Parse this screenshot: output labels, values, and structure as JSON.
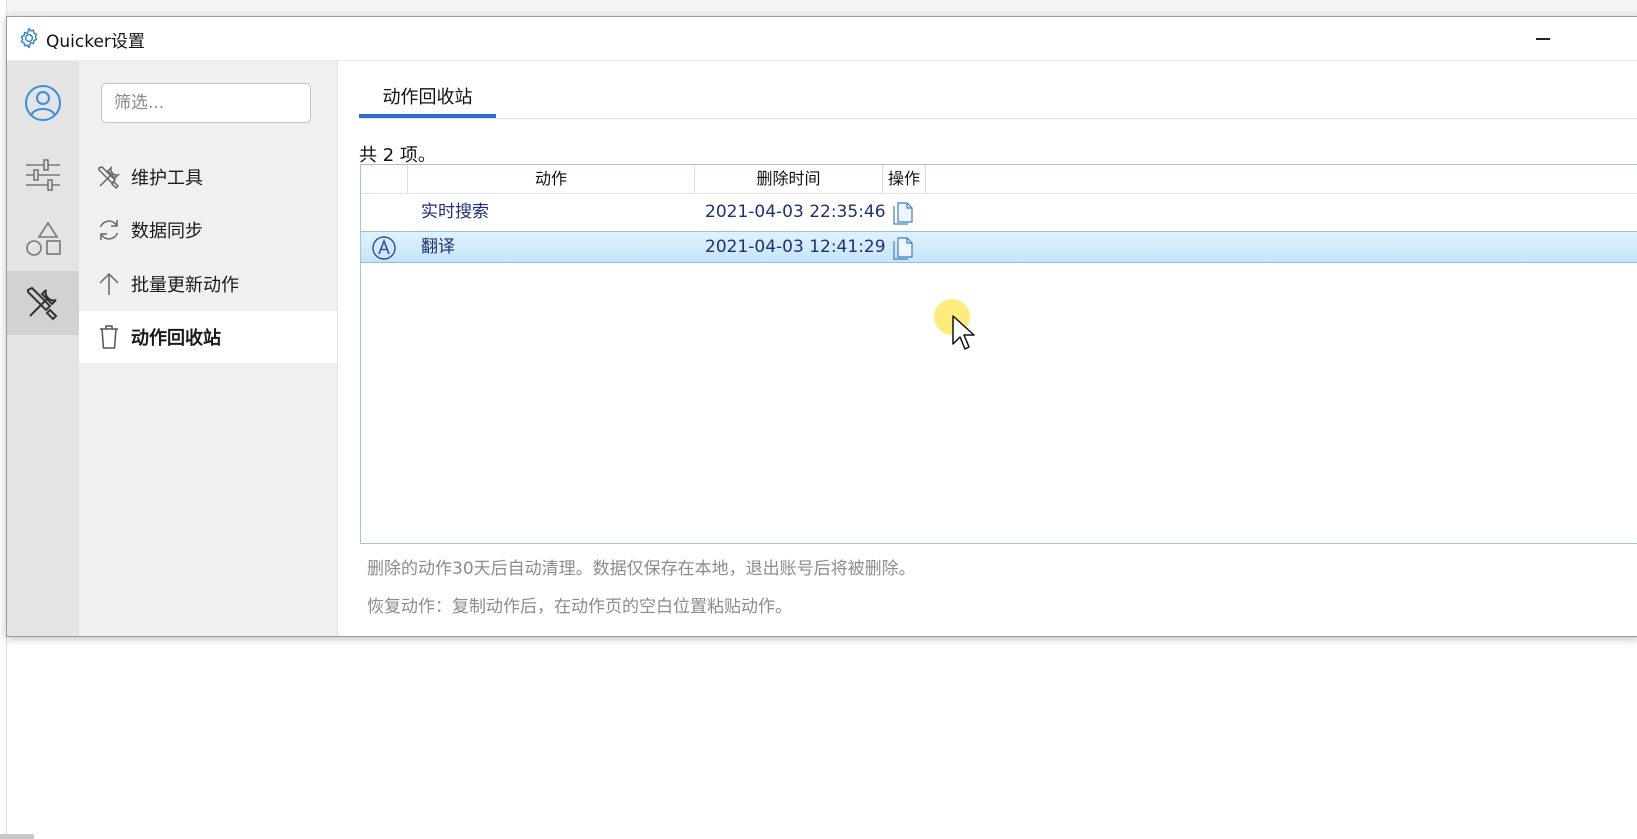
{
  "window": {
    "title": "Quicker设置"
  },
  "rail": {
    "items": [
      {
        "icon": "user-circle-icon"
      },
      {
        "icon": "sliders-icon"
      },
      {
        "icon": "shapes-icon"
      },
      {
        "icon": "tools-icon",
        "active": true
      }
    ]
  },
  "menu": {
    "filter_placeholder": "筛选...",
    "items": [
      {
        "label": "维护工具",
        "icon": "tools-icon"
      },
      {
        "label": "数据同步",
        "icon": "sync-icon"
      },
      {
        "label": "批量更新动作",
        "icon": "arrow-up-icon"
      },
      {
        "label": "动作回收站",
        "icon": "trash-icon",
        "active": true
      }
    ]
  },
  "content": {
    "tab_label": "动作回收站",
    "count_text": "共 2 项。",
    "columns": {
      "action": "动作",
      "deleted_time": "删除时间",
      "operation": "操作"
    },
    "rows": [
      {
        "name": "实时搜索",
        "deleted_time": "2021-04-03 22:35:46",
        "icon": ""
      },
      {
        "name": "翻译",
        "deleted_time": "2021-04-03 12:41:29",
        "icon": "translate-icon",
        "selected": true
      }
    ],
    "notes": [
      "删除的动作30天后自动清理。数据仅保存在本地，退出账号后将被删除。",
      "恢复动作：复制动作后，在动作页的空白位置粘贴动作。"
    ]
  },
  "colors": {
    "accent": "#2b6fd6",
    "selection": "#c6e4fa",
    "link_text": "#1f2f7a"
  }
}
